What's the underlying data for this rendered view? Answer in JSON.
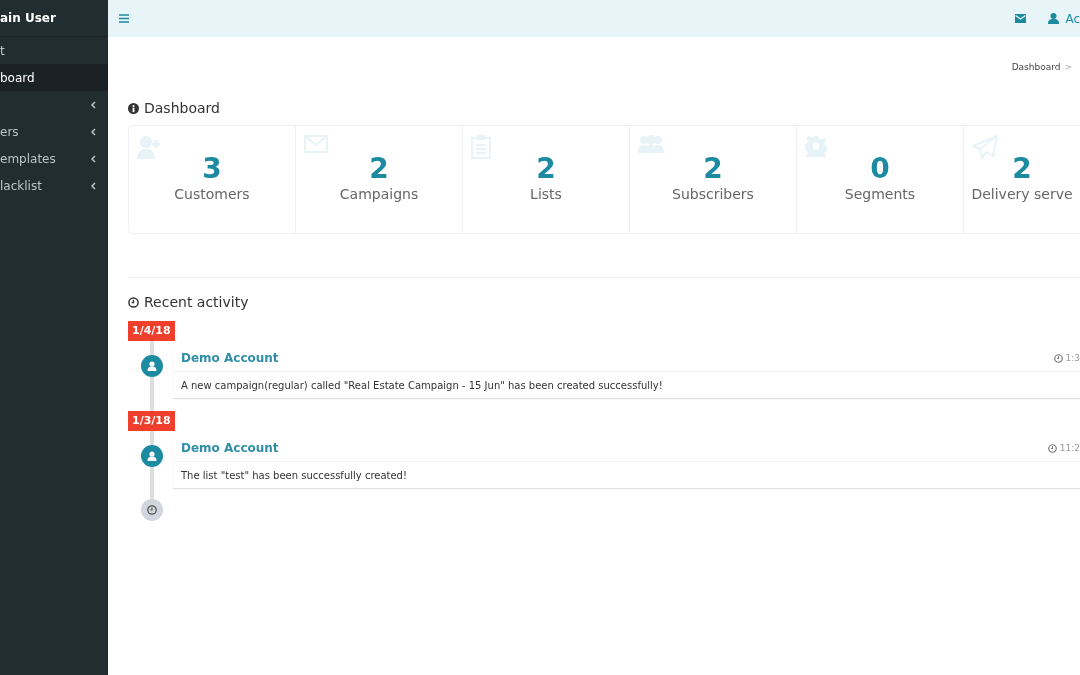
{
  "sidebar": {
    "user_name": "ain User",
    "items": [
      {
        "label": "t",
        "kind": "link",
        "selected": false
      },
      {
        "label": "board",
        "kind": "link",
        "selected": true
      },
      {
        "kind": "submenu",
        "selected": false
      },
      {
        "label": "ers",
        "kind": "submenu",
        "selected": false
      },
      {
        "label": "emplates",
        "kind": "submenu",
        "selected": false
      },
      {
        "label": "lacklist",
        "kind": "submenu",
        "selected": false
      }
    ]
  },
  "topbar": {
    "user_label": "Ac"
  },
  "breadcrumb": [
    "Dashboard",
    ">"
  ],
  "dashboard": {
    "title": "Dashboard",
    "stats": [
      {
        "value": "3",
        "label": "Customers"
      },
      {
        "value": "2",
        "label": "Campaigns"
      },
      {
        "value": "2",
        "label": "Lists"
      },
      {
        "value": "2",
        "label": "Subscribers"
      },
      {
        "value": "0",
        "label": "Segments"
      },
      {
        "value": "2",
        "label": "Delivery serve"
      }
    ]
  },
  "recent_activity": {
    "title": "Recent activity",
    "groups": [
      {
        "date": "1/4/18",
        "items": [
          {
            "author": "Demo Account",
            "time": "1:3",
            "message": "A new campaign(regular) called \"Real Estate Campaign - 15 Jun\" has been created successfully!"
          }
        ]
      },
      {
        "date": "1/3/18",
        "items": [
          {
            "author": "Demo Account",
            "time": "11:2",
            "message": "The list \"test\" has been successfully created!"
          }
        ]
      }
    ]
  }
}
